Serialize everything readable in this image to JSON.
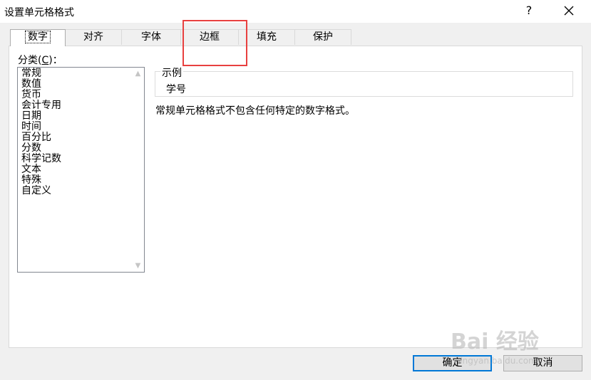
{
  "window": {
    "title": "设置单元格格式",
    "help": "?",
    "close_icon": "close-icon"
  },
  "tabs": [
    {
      "label": "数字",
      "active": true
    },
    {
      "label": "对齐",
      "active": false
    },
    {
      "label": "字体",
      "active": false
    },
    {
      "label": "边框",
      "active": false
    },
    {
      "label": "填充",
      "active": false
    },
    {
      "label": "保护",
      "active": false
    }
  ],
  "category": {
    "label_prefix": "分类(",
    "label_key": "C",
    "label_suffix": ")：",
    "items": [
      "常规",
      "数值",
      "货币",
      "会计专用",
      "日期",
      "时间",
      "百分比",
      "分数",
      "科学记数",
      "文本",
      "特殊",
      "自定义"
    ]
  },
  "sample": {
    "label": "示例",
    "value": "学号"
  },
  "description": "常规单元格格式不包含任何特定的数字格式。",
  "buttons": {
    "ok": "确定",
    "cancel": "取消"
  },
  "watermark": {
    "main": "Bai 经验",
    "sub": "jingyan.baidu.com"
  },
  "colors": {
    "highlight": "#e8403f",
    "default_button_border": "#0078d7"
  }
}
